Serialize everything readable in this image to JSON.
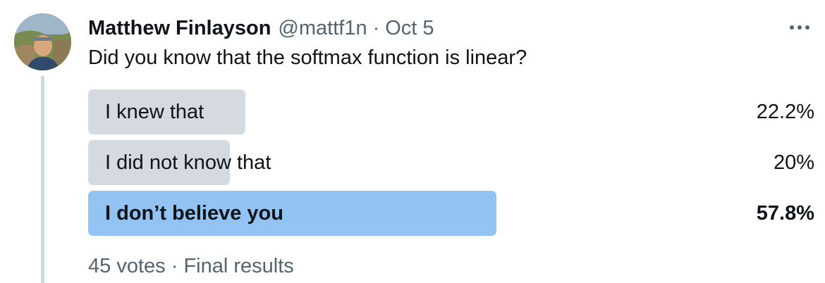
{
  "tweet": {
    "author_name": "Matthew Finlayson",
    "handle": "@mattf1n",
    "separator": "·",
    "date": "Oct 5",
    "more_icon": "more-horizontal-icon",
    "text": "Did you know that the softmax function is linear?"
  },
  "poll": {
    "options": [
      {
        "label": "I knew that",
        "percent_text": "22.2%",
        "percent": 22.2,
        "winner": false
      },
      {
        "label": "I did not know that",
        "percent_text": "20%",
        "percent": 20,
        "winner": false
      },
      {
        "label": "I don’t believe you",
        "percent_text": "57.8%",
        "percent": 57.8,
        "winner": true
      }
    ],
    "votes_text": "45 votes",
    "footer_separator": "·",
    "status_text": "Final results"
  },
  "colors": {
    "bar_default": "#d4dadf",
    "bar_winner": "#93c3f3",
    "secondary_text": "#536471",
    "thread_line": "#cfd9de"
  }
}
